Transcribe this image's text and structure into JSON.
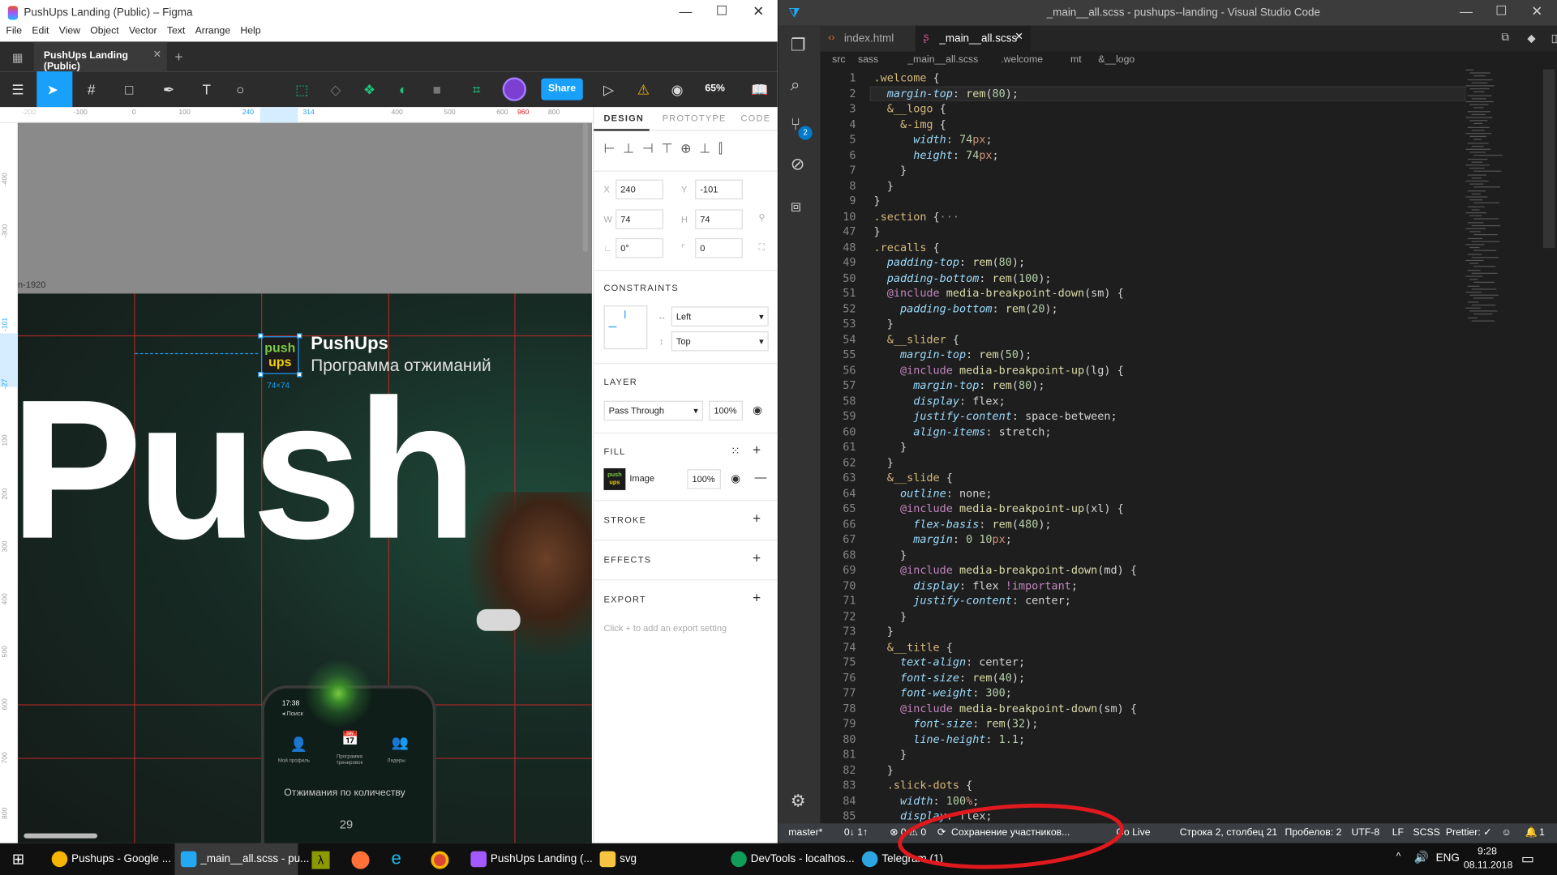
{
  "figma": {
    "window_title": "PushUps Landing (Public) – Figma",
    "menu": [
      "File",
      "Edit",
      "View",
      "Object",
      "Vector",
      "Text",
      "Arrange",
      "Help"
    ],
    "tab_label": "PushUps Landing (Public)",
    "share_label": "Share",
    "zoom": "65%",
    "ruler_h": [
      "-200",
      "-100",
      "0",
      "100",
      "240",
      "314",
      "400",
      "500",
      "600",
      "700",
      "960",
      "800"
    ],
    "ruler_v": [
      "-400",
      "-300",
      "-101",
      "-27",
      "100",
      "200",
      "300",
      "400",
      "500",
      "600",
      "700",
      "800"
    ],
    "frame_label": "in-1920",
    "brand_title": "PushUps",
    "brand_subtitle": "Программа отжиманий",
    "logo_line1": "push",
    "logo_line2": "ups",
    "size_badge": "74×74",
    "hero_text": "Push",
    "phone": {
      "time": "17:38",
      "back": "◂ Поиск",
      "item1": "Мой профиль",
      "item2": "Программа тренировок",
      "item3": "Лидеры",
      "caption": "Отжимания по количеству",
      "number": "29"
    },
    "help": "?",
    "panel": {
      "tabs": [
        "DESIGN",
        "PROTOTYPE",
        "CODE"
      ],
      "x_label": "X",
      "x": "240",
      "y_label": "Y",
      "y": "-101",
      "w_label": "W",
      "w": "74",
      "h_label": "H",
      "h": "74",
      "rot": "0°",
      "radius": "0",
      "constraints": "CONSTRAINTS",
      "c_h": "Left",
      "c_v": "Top",
      "layer": "LAYER",
      "blend": "Pass Through",
      "opacity": "100%",
      "fill": "FILL",
      "fill_type": "Image",
      "fill_opacity": "100%",
      "stroke": "STROKE",
      "effects": "EFFECTS",
      "export": "EXPORT",
      "export_hint": "Click + to add an export setting"
    }
  },
  "vscode": {
    "window_title": "_main__all.scss - pushups--landing - Visual Studio Code",
    "tabs": [
      "index.html",
      "_main__all.scss"
    ],
    "breadcrumb": [
      "src",
      "sass",
      "_main__all.scss",
      ".welcome",
      "mt",
      "&__logo"
    ],
    "status": {
      "branch": "master*",
      "sync": "0↓ 1↑",
      "problems": "⊗ 0 ⚠ 0",
      "saving": "Сохранение участников...",
      "golive": "Go Live",
      "pos": "Строка 2, столбец 21",
      "spaces": "Пробелов: 2",
      "enc": "UTF-8",
      "eol": "LF",
      "lang": "SCSS",
      "prettier": "Prettier: ✓",
      "bell": "1"
    },
    "badge": "2"
  },
  "taskbar": {
    "items": [
      "Pushups - Google ...",
      "_main__all.scss - pu...",
      "PushUps Landing (...",
      "svg",
      "DevTools - localhos...",
      "Telegram (1)"
    ],
    "lang": "ENG",
    "time": "9:28",
    "date": "08.11.2018"
  },
  "colors": {
    "accent": "#18a0fb",
    "brand_green": "#7ac943",
    "annotation": "#e0191e"
  }
}
